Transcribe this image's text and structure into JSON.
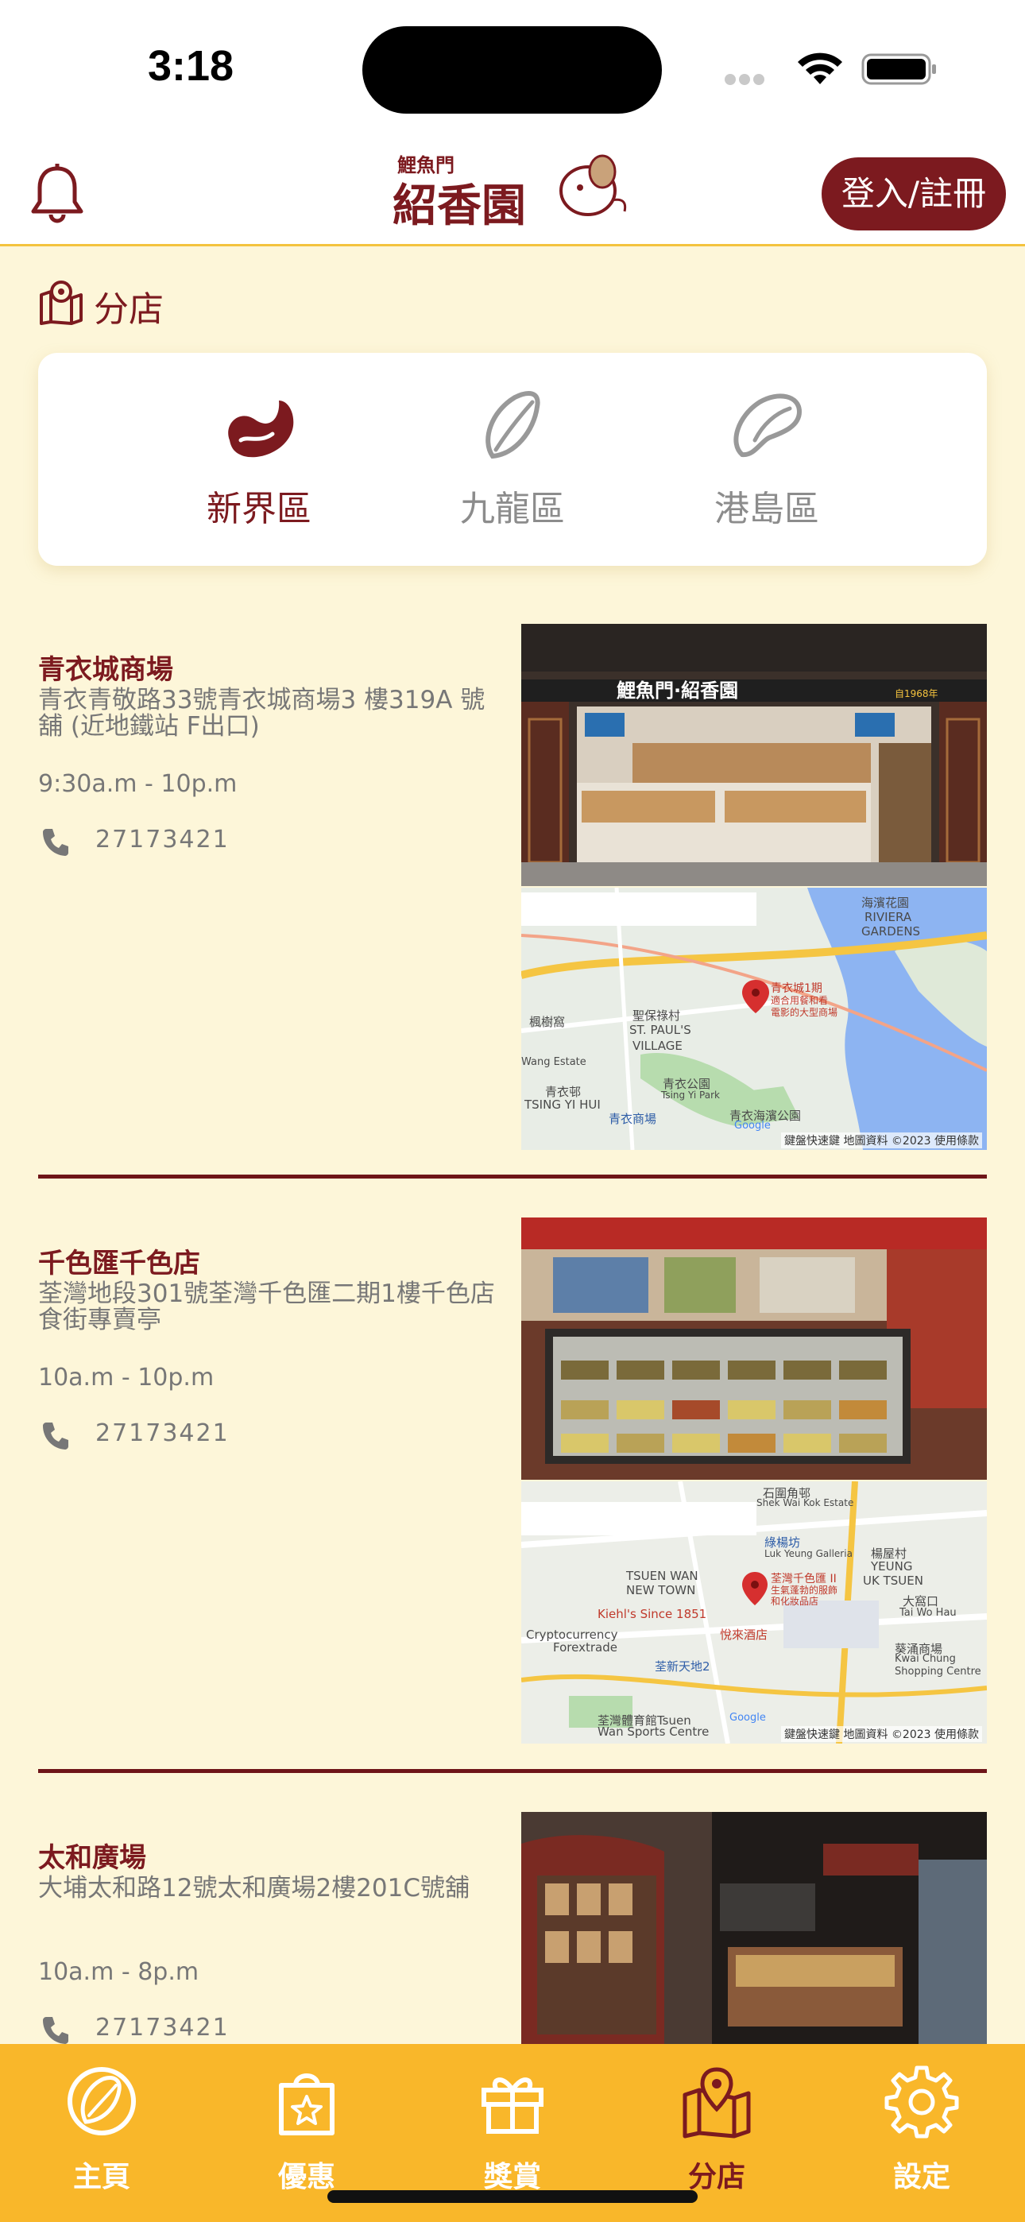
{
  "status_bar": {
    "time": "3:18"
  },
  "header": {
    "logo_text_small": "鯉魚門",
    "logo_text_large": "紹香園",
    "login_label": "登入/註冊"
  },
  "section": {
    "title": "分店"
  },
  "regions": [
    {
      "label": "新界區",
      "active": true
    },
    {
      "label": "九龍區",
      "active": false
    },
    {
      "label": "港島區",
      "active": false
    }
  ],
  "stores": [
    {
      "name": "青衣城商場",
      "address": "青衣青敬路33號青衣城商場3 樓319A 號舖 (近地鐵站 F出口)",
      "hours": "9:30a.m  -  10p.m",
      "phone": "27173421",
      "photo_sign": "鯉魚門·紹香園",
      "photo_badge": "自1968年",
      "map": {
        "labels": [
          "海濱花園",
          "RIVIERA",
          "GARDENS",
          "青衣城1期",
          "適合用餐和看",
          "電影的大型商場",
          "楓樹窩",
          "聖保祿村",
          "ST. PAUL'S",
          "VILLAGE",
          "Wang Estate",
          "青衣邨",
          "TSING YI HUI",
          "青衣公園",
          "Tsing Yi Park",
          "青衣商場",
          "青衣海濱公園",
          "Google"
        ],
        "footer": "鍵盤快速鍵  地圖資料 ©2023  使用條款"
      }
    },
    {
      "name": "千色匯千色店",
      "address": "荃灣地段301號荃灣千色匯二期1樓千色店食街專賣亭",
      "hours": "10a.m  -  10p.m",
      "phone": "27173421",
      "map": {
        "labels": [
          "石圍角邨",
          "Shek Wai Kok Estate",
          "綠楊坊",
          "Luk Yeung Galleria",
          "楊屋村",
          "YEUNG",
          "UK TSUEN",
          "TSUEN WAN",
          "NEW TOWN",
          "荃灣千色匯 II",
          "生氣蓬勃的服飾",
          "和化妝品店",
          "大窩口",
          "Tai Wo Hau",
          "Kiehl's Since 1851",
          "Cryptocurrency",
          "Forextrade",
          "悅來酒店",
          "荃新天地2",
          "葵涌商場",
          "Kwai Chung",
          "Shopping Centre",
          "荃灣體育館Tsuen",
          "Wan Sports Centre",
          "Google"
        ],
        "footer": "鍵盤快速鍵  地圖資料 ©2023  使用條款"
      }
    },
    {
      "name": "太和廣場",
      "address": "大埔太和路12號太和廣場2樓201C號舖",
      "hours": "10a.m  -  8p.m",
      "phone": "27173421"
    }
  ],
  "bottom_nav": [
    {
      "label": "主頁",
      "icon": "almond-icon",
      "active": false
    },
    {
      "label": "優惠",
      "icon": "shopping-bag-star-icon",
      "active": false
    },
    {
      "label": "獎賞",
      "icon": "gift-icon",
      "active": false
    },
    {
      "label": "分店",
      "icon": "map-pin-icon",
      "active": true
    },
    {
      "label": "設定",
      "icon": "gear-icon",
      "active": false
    }
  ],
  "colors": {
    "brand_red": "#7c1a1f",
    "background_cream": "#fdf6d9",
    "nav_yellow": "#f9b72a",
    "inactive_gray": "#8c8c8c"
  }
}
